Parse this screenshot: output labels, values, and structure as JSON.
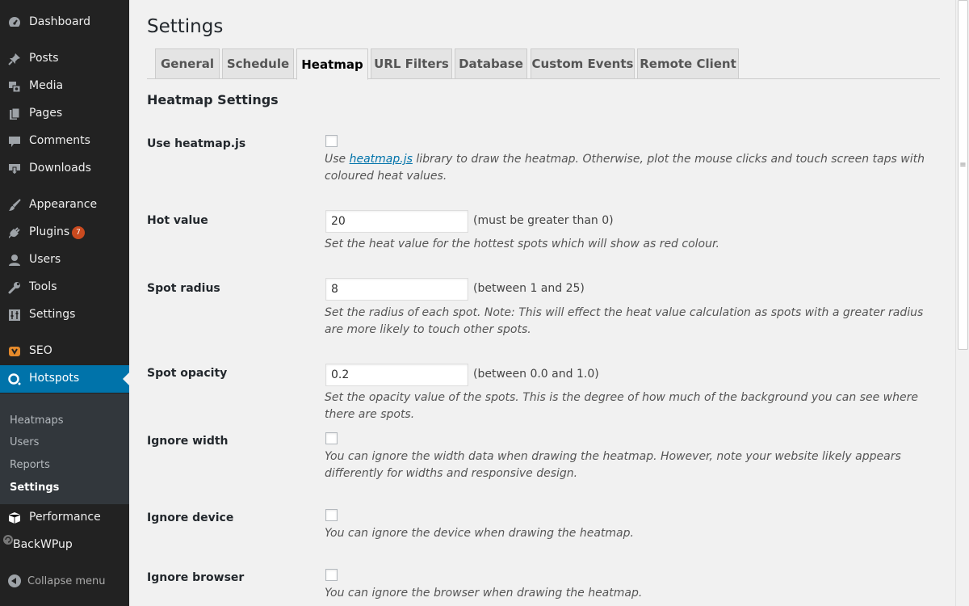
{
  "sidebar": {
    "items": [
      {
        "label": "Dashboard",
        "icon": "dashboard-icon"
      },
      {
        "label": "Posts",
        "icon": "pin-icon"
      },
      {
        "label": "Media",
        "icon": "media-icon"
      },
      {
        "label": "Pages",
        "icon": "pages-icon"
      },
      {
        "label": "Comments",
        "icon": "comment-icon"
      },
      {
        "label": "Downloads",
        "icon": "download-icon"
      },
      {
        "label": "Appearance",
        "icon": "brush-icon"
      },
      {
        "label": "Plugins",
        "icon": "plug-icon",
        "badge": "7"
      },
      {
        "label": "Users",
        "icon": "user-icon"
      },
      {
        "label": "Tools",
        "icon": "wrench-icon"
      },
      {
        "label": "Settings",
        "icon": "sliders-icon"
      },
      {
        "label": "SEO",
        "icon": "seo-icon"
      },
      {
        "label": "Hotspots",
        "icon": "hotspots-icon",
        "current": true
      },
      {
        "label": "Performance",
        "icon": "cube-icon"
      },
      {
        "label": "BackWPup",
        "icon": "backup-icon"
      }
    ],
    "submenu": [
      "Heatmaps",
      "Users",
      "Reports",
      "Settings"
    ],
    "collapse_label": "Collapse menu"
  },
  "page": {
    "title": "Settings",
    "tabs": [
      "General",
      "Schedule",
      "Heatmap",
      "URL Filters",
      "Database",
      "Custom Events",
      "Remote Client"
    ],
    "active_tab": "Heatmap",
    "section_title": "Heatmap Settings"
  },
  "fields": {
    "use_heatmapjs": {
      "label": "Use heatmap.js",
      "checked": false,
      "desc_before": "Use ",
      "desc_link": "heatmap.js",
      "desc_after": " library to draw the heatmap. Otherwise, plot the mouse clicks and touch screen taps with coloured heat values."
    },
    "hot_value": {
      "label": "Hot value",
      "value": "20",
      "hint": "(must be greater than 0)",
      "desc": "Set the heat value for the hottest spots which will show as red colour."
    },
    "spot_radius": {
      "label": "Spot radius",
      "value": "8",
      "hint": "(between 1 and 25)",
      "desc": "Set the radius of each spot. Note: This will effect the heat value calculation as spots with a greater radius are more likely to touch other spots."
    },
    "spot_opacity": {
      "label": "Spot opacity",
      "value": "0.2",
      "hint": "(between 0.0 and 1.0)",
      "desc": "Set the opacity value of the spots. This is the degree of how much of the background you can see where there are spots."
    },
    "ignore_width": {
      "label": "Ignore width",
      "checked": false,
      "desc": "You can ignore the width data when drawing the heatmap. However, note your website likely appears differently for widths and responsive design."
    },
    "ignore_device": {
      "label": "Ignore device",
      "checked": false,
      "desc": "You can ignore the device when drawing the heatmap."
    },
    "ignore_browser": {
      "label": "Ignore browser",
      "checked": false,
      "desc": "You can ignore the browser when drawing the heatmap."
    }
  },
  "colors": {
    "sidebar_bg": "#222222",
    "submenu_bg": "#32373c",
    "accent": "#0073aa",
    "badge": "#ca4a1f",
    "content_bg": "#f1f1f1"
  }
}
